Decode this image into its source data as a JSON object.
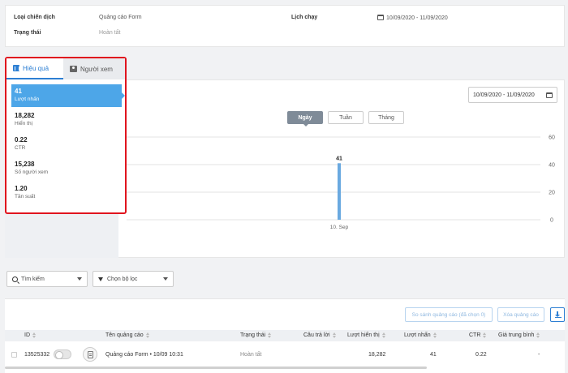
{
  "campaign": {
    "type_label": "Loại chiến dịch",
    "type_value": "Quảng cáo Form",
    "status_label": "Trạng thái",
    "status_value": "Hoàn tất",
    "schedule_label": "Lịch chạy",
    "schedule_value": "10/09/2020 - 11/09/2020"
  },
  "tabs": [
    {
      "label": "Hiệu quả",
      "active": true,
      "icon": "bar-chart-icon"
    },
    {
      "label": "Người xem",
      "active": false,
      "icon": "user-card-icon"
    }
  ],
  "metrics": [
    {
      "value": "41",
      "label": "Lượt nhấn",
      "active": true
    },
    {
      "value": "18,282",
      "label": "Hiển thị",
      "active": false
    },
    {
      "value": "0.22",
      "label": "CTR",
      "active": false
    },
    {
      "value": "15,238",
      "label": "Số người xem",
      "active": false
    },
    {
      "value": "1.20",
      "label": "Tần suất",
      "active": false
    }
  ],
  "chart_controls": {
    "date_range": "10/09/2020 - 11/09/2020",
    "periods": [
      {
        "label": "Ngày",
        "active": true
      },
      {
        "label": "Tuần",
        "active": false
      },
      {
        "label": "Tháng",
        "active": false
      }
    ]
  },
  "chart_data": {
    "type": "bar",
    "categories": [
      "10. Sep"
    ],
    "values": [
      41
    ],
    "data_labels": [
      "41"
    ],
    "yticks": [
      0,
      20,
      40,
      60
    ],
    "ylim": [
      0,
      60
    ],
    "grid": true,
    "color": "#6aa9e0",
    "title": "",
    "xlabel": "",
    "ylabel": ""
  },
  "filters": {
    "search_label": "Tìm kiếm",
    "filter_label": "Chọn bộ lọc"
  },
  "table": {
    "compare_button": "So sánh quảng cáo (đã chọn 0)",
    "delete_button": "Xóa quảng cáo",
    "columns": [
      "ID",
      "Tên quảng cáo",
      "Trạng thái",
      "Câu trả lời",
      "Lượt hiển thị",
      "Lượt nhấn",
      "CTR",
      "Giá trung bình"
    ],
    "rows": [
      {
        "id": "13525332",
        "name": "Quảng cáo Form • 10/09 10:31",
        "status": "Hoàn tất",
        "answers": "",
        "impressions": "18,282",
        "clicks": "41",
        "ctr": "0.22",
        "avg_price": "-"
      }
    ]
  },
  "colors": {
    "accent": "#2d7fd3",
    "active_metric": "#4da6e8",
    "highlight_border": "#e0141e"
  }
}
